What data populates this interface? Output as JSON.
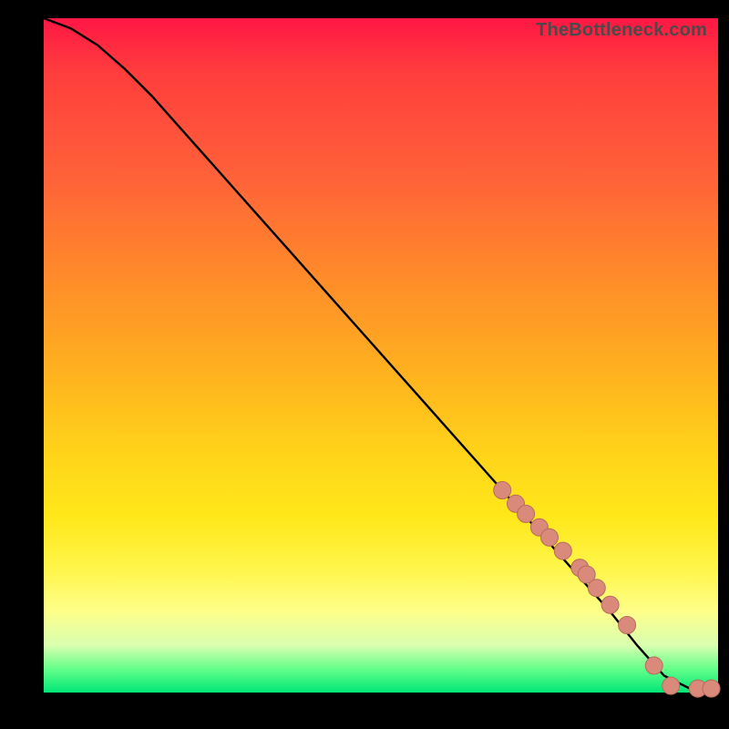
{
  "watermark": "TheBottleneck.com",
  "colors": {
    "curve": "#000000",
    "marker_fill": "#d98a7a",
    "marker_stroke": "#b96a5a",
    "bg_black": "#000000"
  },
  "chart_data": {
    "type": "line",
    "title": "",
    "xlabel": "",
    "ylabel": "",
    "xlim": [
      0,
      100
    ],
    "ylim": [
      0,
      100
    ],
    "grid": false,
    "x": [
      0,
      4,
      8,
      12,
      16,
      20,
      24,
      28,
      32,
      36,
      40,
      44,
      48,
      52,
      56,
      60,
      64,
      68,
      72,
      76,
      80,
      84,
      88,
      92,
      96,
      100
    ],
    "y": [
      100,
      98.5,
      96,
      92.5,
      88.5,
      84,
      79.5,
      75,
      70.5,
      66,
      61.5,
      57,
      52.5,
      48,
      43.5,
      39,
      34.5,
      30,
      25.5,
      21,
      16.5,
      12,
      7,
      2.5,
      0.5,
      0.5
    ],
    "markers": {
      "x": [
        68,
        70,
        71.5,
        73.5,
        75,
        77,
        79.5,
        80.5,
        82,
        84,
        86.5,
        90.5,
        93,
        97,
        99
      ],
      "y": [
        30,
        28,
        26.5,
        24.5,
        23,
        21,
        18.5,
        17.5,
        15.5,
        13,
        10,
        4,
        1,
        0.6,
        0.6
      ]
    }
  }
}
